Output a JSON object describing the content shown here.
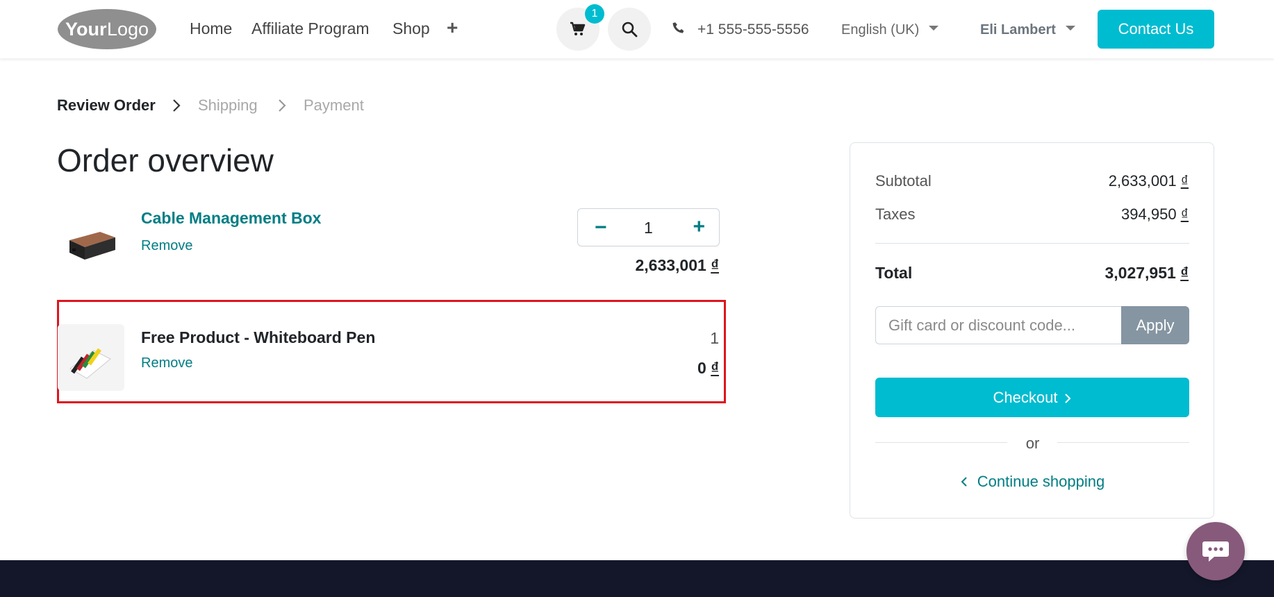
{
  "header": {
    "logo_text_bold": "Your",
    "logo_text_light": "Logo",
    "nav": [
      "Home",
      "Affiliate Program",
      "Shop"
    ],
    "nav_add": "+",
    "cart_count": "1",
    "phone": "+1 555-555-5556",
    "language": "English (UK)",
    "user": "Eli Lambert",
    "contact_label": "Contact Us"
  },
  "breadcrumb": {
    "steps": [
      "Review Order",
      "Shipping",
      "Payment"
    ],
    "active_index": 0
  },
  "page_title": "Order overview",
  "lines": [
    {
      "name": "Cable Management Box",
      "remove": "Remove",
      "quantity": "1",
      "price": "2,633,001",
      "currency": "₫"
    },
    {
      "name": "Free Product - Whiteboard Pen",
      "remove": "Remove",
      "quantity": "1",
      "price": "0",
      "currency": "₫"
    }
  ],
  "summary": {
    "subtotal_label": "Subtotal",
    "subtotal_value": "2,633,001",
    "taxes_label": "Taxes",
    "taxes_value": "394,950",
    "total_label": "Total",
    "total_value": "3,027,951",
    "currency": "₫",
    "coupon_placeholder": "Gift card or discount code...",
    "apply_label": "Apply",
    "checkout_label": "Checkout",
    "or_label": "or",
    "continue_label": "Continue shopping"
  },
  "colors": {
    "primary": "#00bcd0",
    "link": "#017e84",
    "highlight": "#e0141e",
    "footer": "#131729",
    "chat": "#875a7b"
  },
  "icons": {
    "cart": "cart-icon",
    "search": "search-icon",
    "phone": "phone-icon",
    "chat": "chat-icon"
  }
}
